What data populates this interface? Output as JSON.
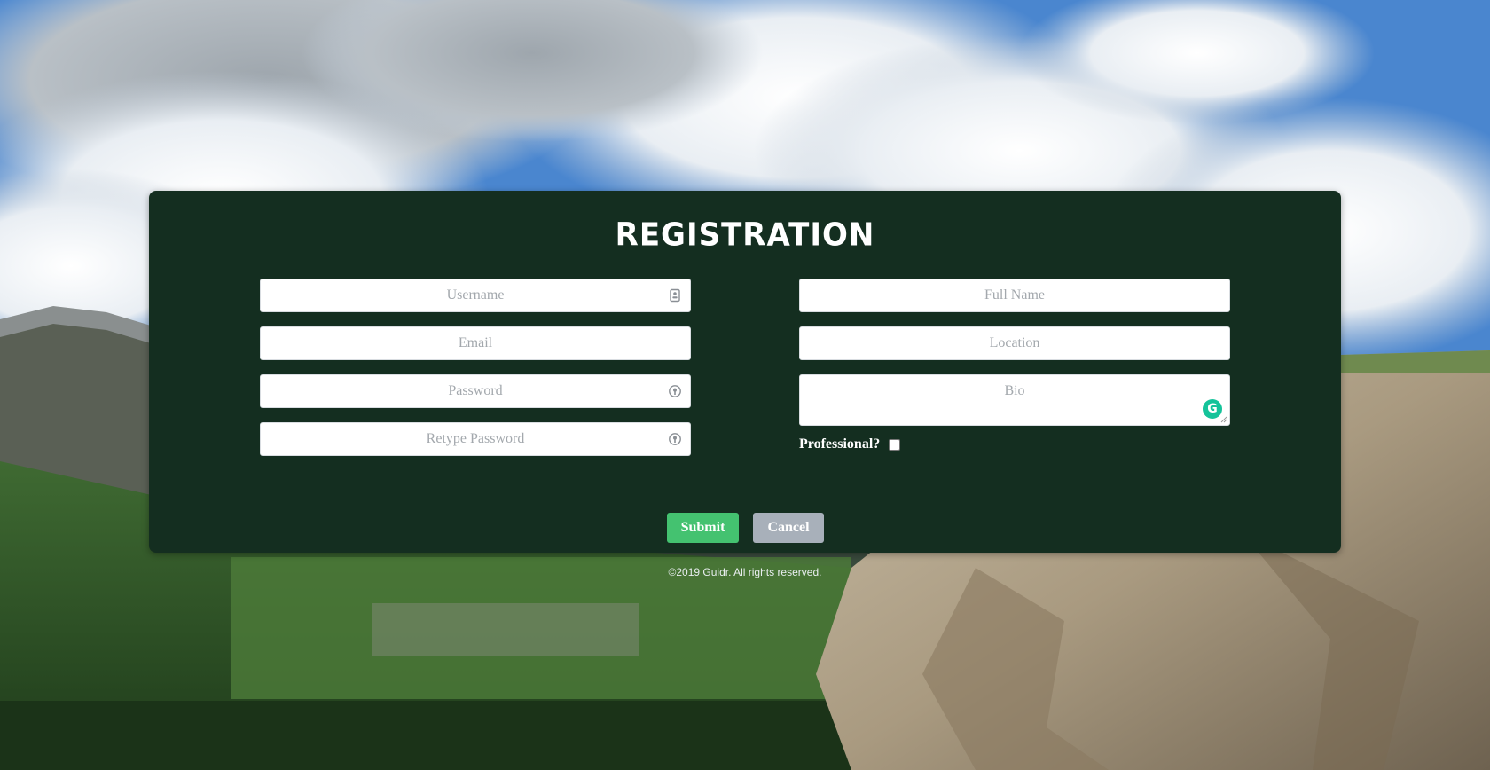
{
  "form": {
    "title": "REGISTRATION",
    "fields": {
      "username_placeholder": "Username",
      "email_placeholder": "Email",
      "password_placeholder": "Password",
      "retype_password_placeholder": "Retype Password",
      "full_name_placeholder": "Full Name",
      "location_placeholder": "Location",
      "bio_placeholder": "Bio"
    },
    "professional_label": "Professional?",
    "professional_checked": false,
    "submit_label": "Submit",
    "cancel_label": "Cancel"
  },
  "footer": {
    "copyright": "©2019 Guidr. All rights reserved."
  },
  "colors": {
    "panel": "#142e20",
    "submit": "#44c270",
    "cancel": "#a8b0ba",
    "grammarly": "#15c39a"
  },
  "icons": {
    "username": "contact-card-icon",
    "password": "password-key-icon",
    "retype_password": "password-key-icon",
    "bio": "grammarly-icon"
  }
}
